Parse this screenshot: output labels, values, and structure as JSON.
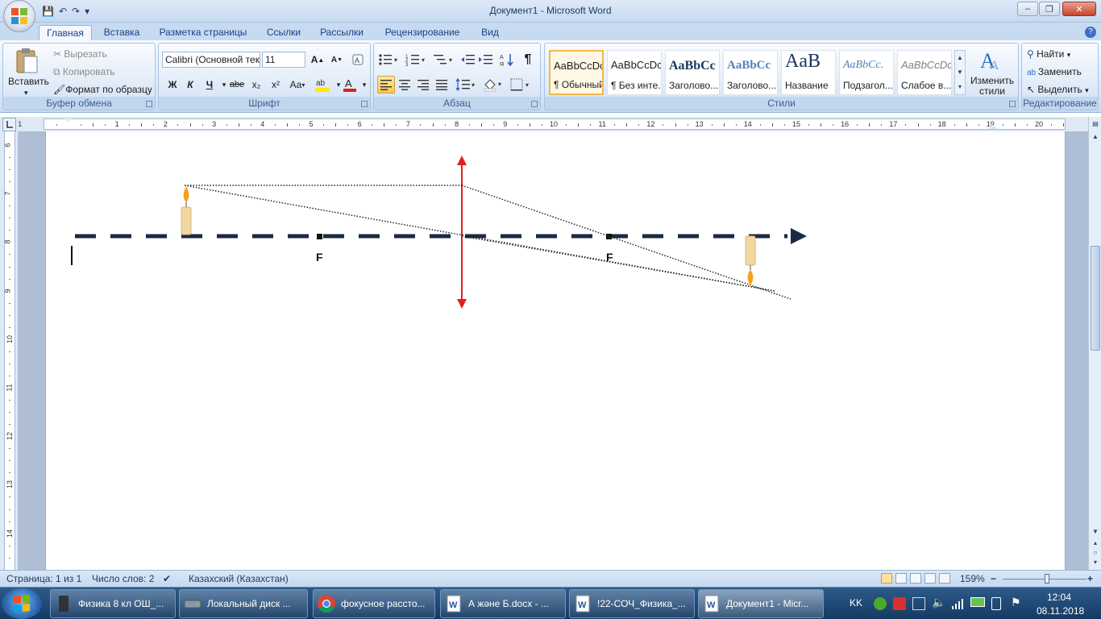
{
  "window": {
    "title": "Документ1 - Microsoft Word",
    "minimize": "–",
    "maximize": "❐",
    "close": "✕"
  },
  "qat": {
    "save": "💾",
    "undo": "↶",
    "redo": "↷",
    "more": "▾"
  },
  "tabs": [
    "Главная",
    "Вставка",
    "Разметка страницы",
    "Ссылки",
    "Рассылки",
    "Рецензирование",
    "Вид"
  ],
  "clipboard": {
    "paste": "Вставить",
    "cut": "Вырезать",
    "copy": "Копировать",
    "format_painter": "Формат по образцу",
    "label": "Буфер обмена"
  },
  "font": {
    "family": "Calibri (Основной текст)",
    "size": "11",
    "label": "Шрифт",
    "bold": "Ж",
    "italic": "К",
    "underline": "Ч",
    "strike": "abe",
    "subscript": "x₂",
    "superscript": "x²",
    "change_case": "Aa",
    "grow": "A",
    "shrink": "A"
  },
  "paragraph": {
    "label": "Абзац",
    "pilcrow": "¶"
  },
  "styles": {
    "label": "Стили",
    "items": [
      {
        "sample": "AaBbCcDc",
        "name": "¶ Обычный"
      },
      {
        "sample": "AaBbCcDc",
        "name": "¶ Без инте..."
      },
      {
        "sample": "AaBbCc",
        "name": "Заголово..."
      },
      {
        "sample": "AaBbCc",
        "name": "Заголово..."
      },
      {
        "sample": "AaB",
        "name": "Название"
      },
      {
        "sample": "AaBbCc.",
        "name": "Подзагол..."
      },
      {
        "sample": "AaBbCcDc",
        "name": "Слабое в..."
      }
    ],
    "change_styles": "Изменить стили"
  },
  "editing": {
    "label": "Редактирование",
    "find": "Найти",
    "replace": "Заменить",
    "select": "Выделить"
  },
  "ruler": {
    "h_numbers": [
      "1",
      "1",
      "2",
      "3",
      "4",
      "5",
      "6",
      "7",
      "8",
      "9",
      "10",
      "11",
      "12",
      "13",
      "14",
      "15",
      "16",
      "17",
      "18",
      "19",
      "20"
    ],
    "v_numbers": [
      "6",
      "7",
      "8",
      "9",
      "10",
      "11",
      "12",
      "13",
      "14"
    ]
  },
  "diagram": {
    "focus_left": "F",
    "focus_right": "F",
    "colors": {
      "axis": "#1a2a42",
      "lens": "#e02020",
      "ray": "#222222",
      "candle": "#f2d7a3"
    }
  },
  "status": {
    "page": "Страница: 1 из 1",
    "words": "Число слов: 2",
    "language": "Казахский (Казахстан)",
    "zoom": "159%",
    "zoom_out": "−",
    "zoom_in": "+"
  },
  "taskbar": {
    "items": [
      {
        "label": "Физика 8 кл ОШ_..."
      },
      {
        "label": "Локальный диск ..."
      },
      {
        "label": "фокусное рассто..."
      },
      {
        "label": "А және Б.docx - ..."
      },
      {
        "label": "!22-СОЧ_Физика_..."
      },
      {
        "label": "Документ1 - Micr..."
      }
    ],
    "lang": "KK",
    "time": "12:04",
    "date": "08.11.2018"
  }
}
